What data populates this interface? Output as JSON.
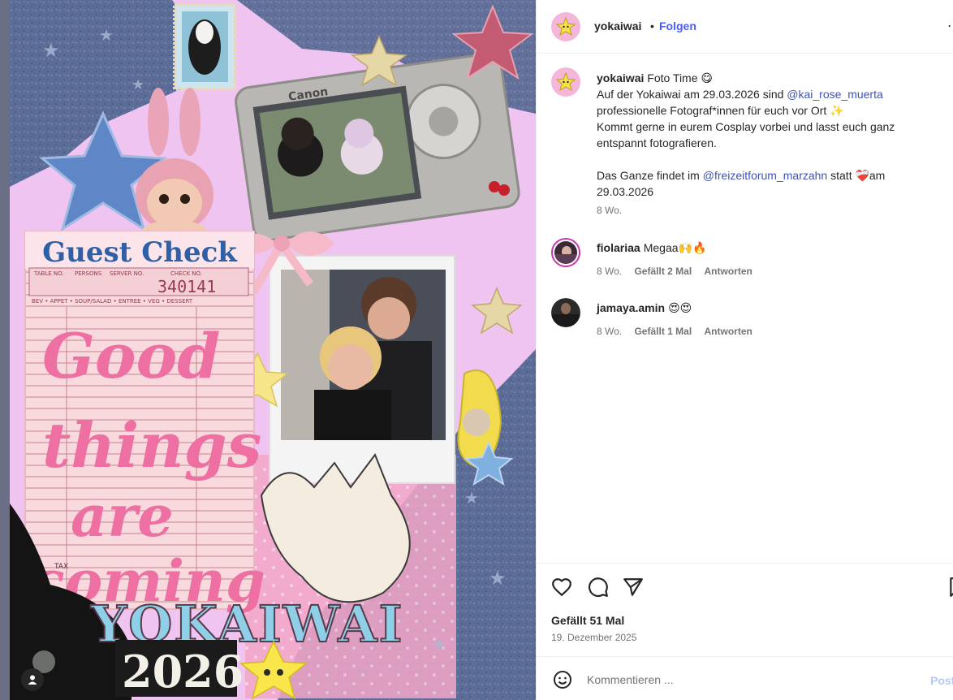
{
  "post": {
    "username": "yokaiwai",
    "follow_label": "Folgen",
    "separator": "•",
    "more_icon": "more-icon"
  },
  "image": {
    "ticket_title": "Guest Check",
    "ticket_cols": [
      "TABLE NO.",
      "PERSONS",
      "SERVER NO.",
      "CHECK NO."
    ],
    "ticket_number": "340141",
    "ticket_row": "BEV • APPET • SOUP/SALAD • ENTREE • VEG • DESSERT",
    "ticket_tax": "TAX",
    "handwriting": [
      "Good",
      "things",
      "are",
      "coming"
    ],
    "brand": "YOKAIWAI",
    "year": "2026",
    "camera_brand": "Canon"
  },
  "caption": {
    "username": "yokaiwai",
    "line1": " Foto Time 😋",
    "line2_a": "Auf der Yokaiwai am 29.03.2026 sind ",
    "mention1": "@kai_rose_muerta",
    "line3": "professionelle Fotograf*innen für euch vor Ort ✨",
    "line4": "Kommt gerne in eurem Cosplay vorbei und lasst euch ganz",
    "line5": "entspannt fotografieren.",
    "line6_a": "Das Ganze findet im ",
    "mention2": "@freizeitforum_marzahn",
    "line6_b": " statt ❤️‍🩹am",
    "line7": "29.03.2026",
    "time": "8 Wo."
  },
  "comments": [
    {
      "username": "fiolariaa",
      "text": "Megaa🙌🔥",
      "time": "8 Wo.",
      "likes": "Gefällt 2 Mal",
      "reply": "Antworten"
    },
    {
      "username": "jamaya.amin",
      "text": "😍😍",
      "time": "8 Wo.",
      "likes": "Gefällt 1 Mal",
      "reply": "Antworten"
    }
  ],
  "footer": {
    "likes": "Gefällt 51 Mal",
    "date": "19. Dezember 2025",
    "comment_placeholder": "Kommentieren ...",
    "post_label": "Post"
  },
  "colors": {
    "accent": "#4a5df9",
    "mention": "#3f53b6",
    "muted": "#737373",
    "image_pink": "#f0c6ef",
    "denim": "#5d6e97"
  }
}
